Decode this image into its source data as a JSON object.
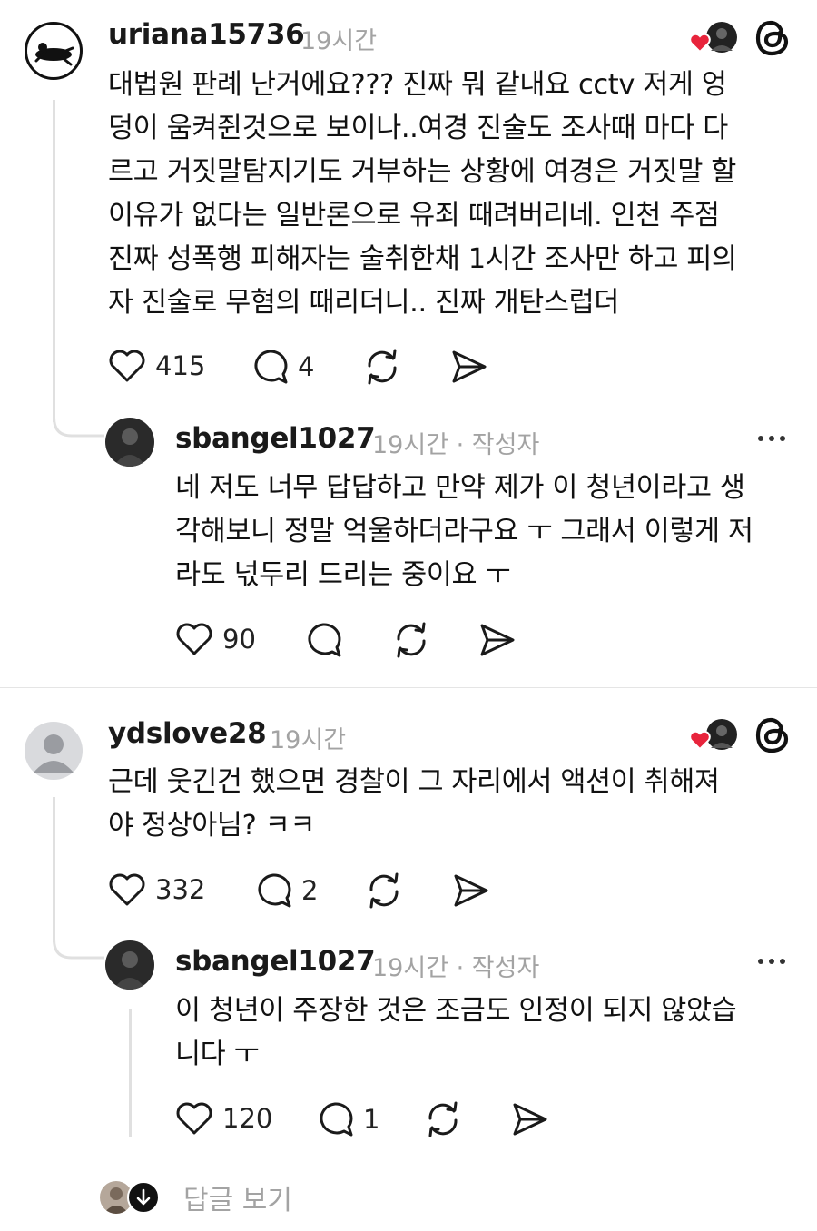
{
  "comments": [
    {
      "username": "uriana15736",
      "time": "19시간",
      "lines": [
        "대법원 판례 난거에요??? 진짜 뭐 같내요 cctv 저게 엉",
        "덩이 움켜쥔것으로 보이나..여경 진술도 조사때 마다 다",
        "르고 거짓말탐지기도 거부하는 상황에 여경은 거짓말 할",
        "이유가 없다는 일반론으로 유죄 때려버리네. 인천 주점",
        "진짜 성폭행 피해자는 술취한채 1시간 조사만 하고 피의",
        "자 진술로 무혐의 때리더니.. 진짜 개탄스럽더"
      ],
      "likes": "415",
      "replies": "4",
      "reply": {
        "username": "sbangel1027",
        "time": "19시간 · 작성자",
        "lines": [
          "네 저도 너무 답답하고 만약  제가 이 청년이라고 생",
          "각해보니 정말 억울하더라구요 ㅜ 그래서 이렇게 저",
          "라도 넋두리 드리는 중이요 ㅜ"
        ],
        "likes": "90"
      }
    },
    {
      "username": "ydslove28",
      "time": "19시간",
      "lines": [
        "근데 웃긴건 했으면 경찰이 그 자리에서  액션이 취해져",
        "야 정상아님? ㅋㅋ"
      ],
      "likes": "332",
      "replies": "2",
      "reply": {
        "username": "sbangel1027",
        "time": "19시간 · 작성자",
        "lines": [
          "이 청년이 주장한 것은 조금도 인정이 되지 않았습",
          "니다 ㅜ"
        ],
        "likes": "120",
        "replies": "1"
      }
    }
  ],
  "footer": {
    "view_replies": "답글 보기"
  },
  "colors": {
    "heart_red": "#e8243c",
    "muted": "#a3a3a3",
    "icon": "#1a1a1a"
  }
}
